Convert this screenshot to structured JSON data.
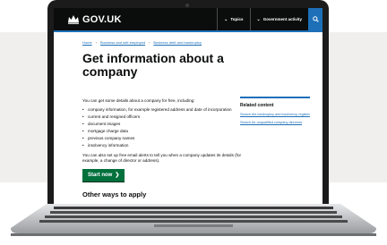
{
  "header": {
    "logo_text": "GOV.UK",
    "menu_topics": "Topics",
    "menu_government": "Government activity"
  },
  "breadcrumb": [
    "Home",
    "Business and self-employed",
    "Business debt and bankruptcy"
  ],
  "page": {
    "title": "Get information about a company",
    "intro": "You can get some details about a company for free, including:",
    "bullets": [
      "company information, for example registered address and date of incorporation",
      "current and resigned officers",
      "document images",
      "mortgage charge data",
      "previous company names",
      "insolvency information"
    ],
    "alerts_text": "You can also set up free email alerts to tell you when a company updates its details (for example, a change of director or address).",
    "start_button": "Start now",
    "other_ways": "Other ways to apply"
  },
  "related": {
    "heading": "Related content",
    "links": [
      "Search the bankruptcy and insolvency register",
      "Search for unqualified company directors"
    ]
  },
  "colors": {
    "header_bg": "#0b0c0c",
    "brand_blue": "#1d70b8",
    "start_green": "#00703c",
    "background_panel": "#f1efee"
  }
}
